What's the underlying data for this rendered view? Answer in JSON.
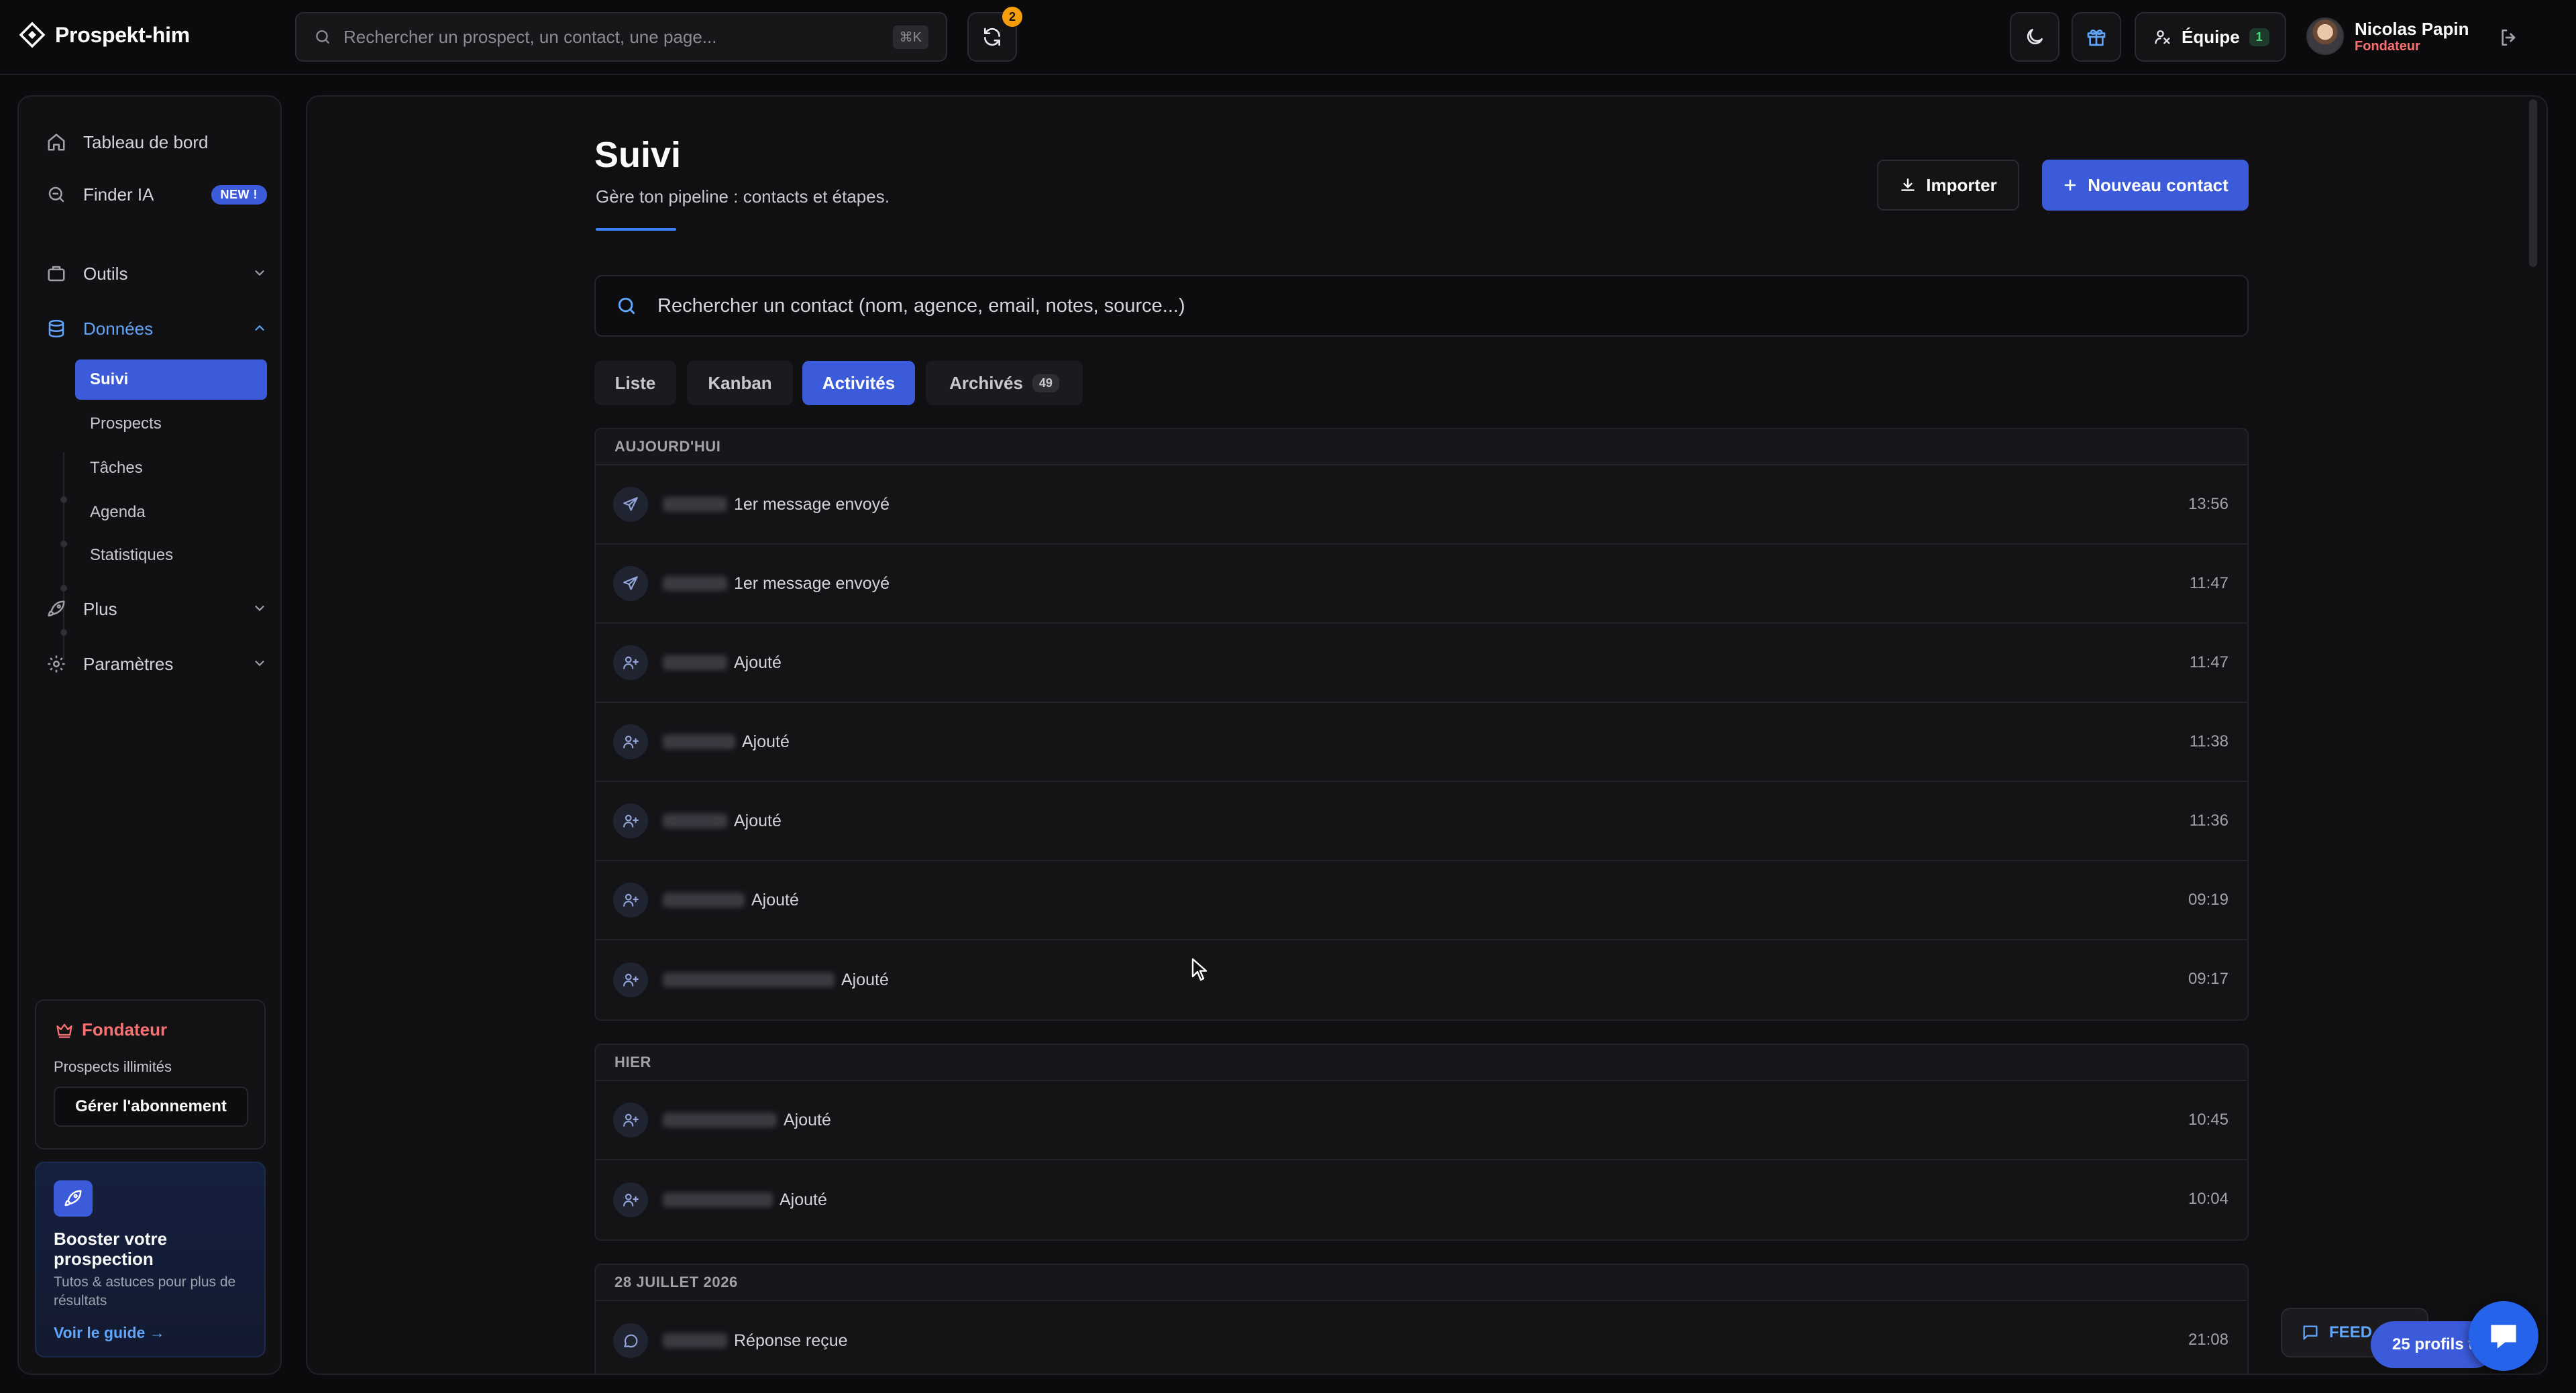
{
  "app": {
    "name": "Prospekt-him"
  },
  "topbar": {
    "search_placeholder": "Rechercher un prospect, un contact, une page...",
    "search_shortcut": "⌘K",
    "sync_badge": "2",
    "team_label": "Équipe",
    "team_count": "1",
    "user_name": "Nicolas Papin",
    "user_role": "Fondateur"
  },
  "sidebar": {
    "items": [
      {
        "label": "Tableau de bord",
        "icon": "home-icon"
      },
      {
        "label": "Finder IA",
        "icon": "search-icon",
        "badge": "NEW !"
      },
      {
        "label": "Outils",
        "icon": "briefcase-icon"
      },
      {
        "label": "Données",
        "icon": "database-icon"
      },
      {
        "label": "Plus",
        "icon": "rocket-icon"
      },
      {
        "label": "Paramètres",
        "icon": "gear-icon"
      }
    ],
    "sub_items": [
      {
        "label": "Suivi"
      },
      {
        "label": "Prospects"
      },
      {
        "label": "Tâches"
      },
      {
        "label": "Agenda"
      },
      {
        "label": "Statistiques"
      }
    ],
    "plan": {
      "title": "Fondateur",
      "subtitle": "Prospects illimités",
      "button": "Gérer l'abonnement"
    },
    "boost": {
      "title": "Booster votre prospection",
      "description": "Tutos & astuces pour plus de résultats",
      "link": "Voir le guide →"
    }
  },
  "page": {
    "title": "Suivi",
    "subtitle": "Gère ton pipeline : contacts et étapes.",
    "import_label": "Importer",
    "new_contact_label": "Nouveau contact",
    "search_placeholder": "Rechercher un contact (nom, agence, email, notes, source...)"
  },
  "tabs": [
    {
      "label": "Liste"
    },
    {
      "label": "Kanban"
    },
    {
      "label": "Activités",
      "active": true
    },
    {
      "label": "Archivés",
      "count": "49"
    }
  ],
  "activity_groups": [
    {
      "header": "AUJOURD'HUI",
      "rows": [
        {
          "icon": "send-icon",
          "text": "1er message envoyé",
          "time": "13:56"
        },
        {
          "icon": "send-icon",
          "text": "1er message envoyé",
          "time": "11:47"
        },
        {
          "icon": "user-plus-icon",
          "text": "Ajouté",
          "time": "11:47"
        },
        {
          "icon": "user-plus-icon",
          "text": "Ajouté",
          "time": "11:38"
        },
        {
          "icon": "user-plus-icon",
          "text": "Ajouté",
          "time": "11:36"
        },
        {
          "icon": "user-plus-icon",
          "text": "Ajouté",
          "time": "09:19"
        },
        {
          "icon": "user-plus-icon",
          "text": "Ajouté",
          "time": "09:17"
        }
      ]
    },
    {
      "header": "HIER",
      "rows": [
        {
          "icon": "user-plus-icon",
          "text": "Ajouté",
          "time": "10:45"
        },
        {
          "icon": "user-plus-icon",
          "text": "Ajouté",
          "time": "10:04"
        }
      ]
    },
    {
      "header": "28 JUILLET 2026",
      "rows": [
        {
          "icon": "message-icon",
          "text": "Réponse reçue",
          "time": "21:08"
        }
      ]
    }
  ],
  "floating": {
    "feedback_label": "FEED",
    "profiles_label": "25 profils t"
  },
  "colors": {
    "accent": "#3b5bdb",
    "link": "#60a5fa",
    "role": "#f87171",
    "background": "#0b0b0d"
  }
}
